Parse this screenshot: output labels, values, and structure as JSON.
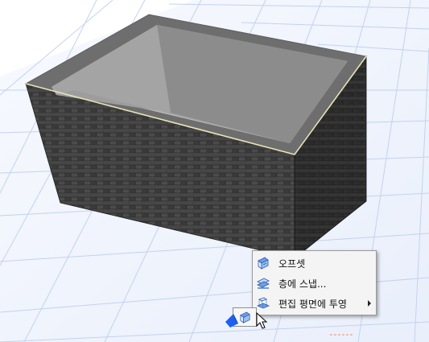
{
  "colors": {
    "grid_line": "#b8c9ec",
    "grid_floor": "#eef3fc",
    "wall_brick": "#3f3f3f",
    "wall_top": "#6f6f6f",
    "inner_wall": "#9a9a9a",
    "selection_blue": "#1e5ef0",
    "highlight_edge": "#e8e2b8"
  },
  "context_menu": {
    "items": [
      {
        "label": "오프셋",
        "icon": "offset-icon"
      },
      {
        "label": "층에 스냅...",
        "icon": "snap-to-story-icon"
      },
      {
        "label": "편집 평면에 투영",
        "icon": "project-to-edit-plane-icon",
        "has_submenu": true
      }
    ]
  },
  "pet_palette": {
    "icon": "offset-icon"
  }
}
